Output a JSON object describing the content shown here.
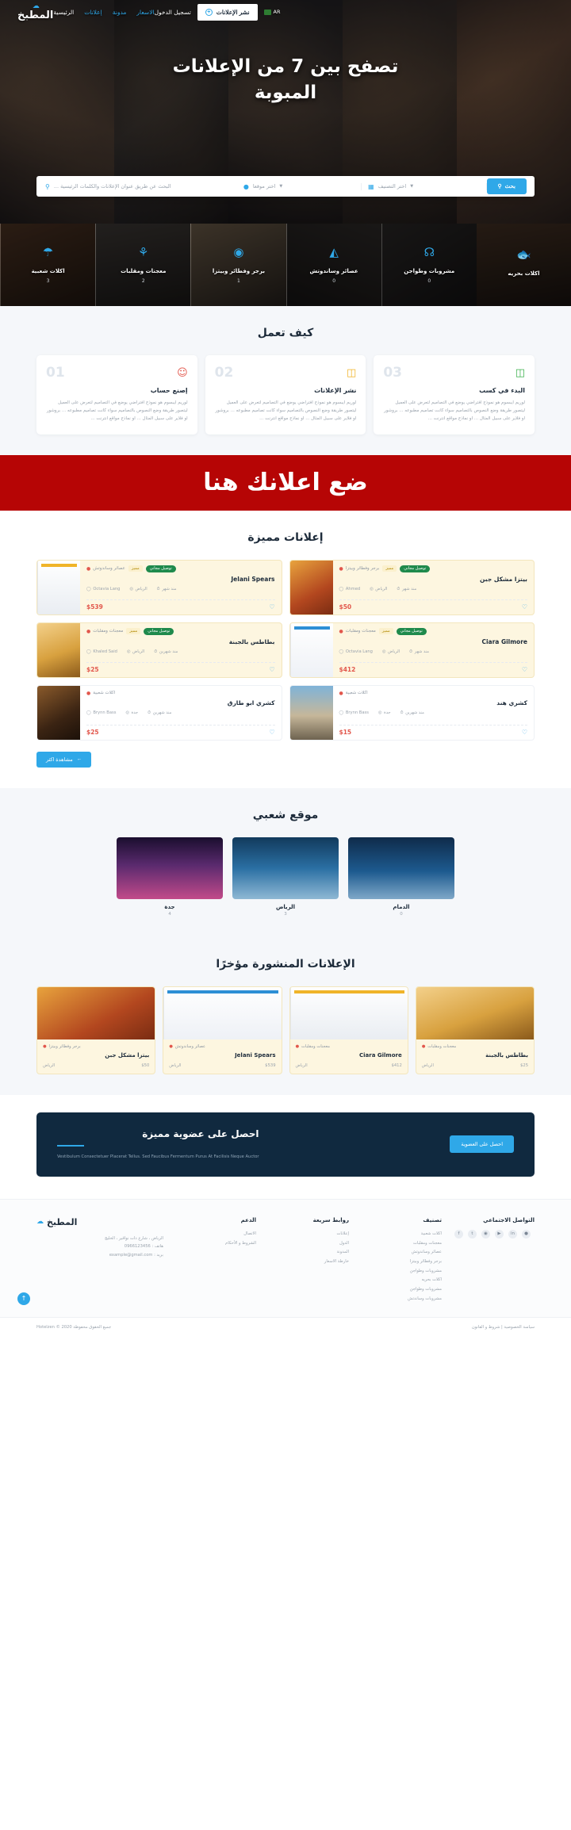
{
  "nav": {
    "logo_text": "المطبخ",
    "links": [
      {
        "label": "الرئيسية",
        "active": false
      },
      {
        "label": "إعلانات",
        "active": true
      },
      {
        "label": "مدونة",
        "active": true
      },
      {
        "label": "الاسعار",
        "active": true
      }
    ],
    "login_label": "تسجيل الدخول",
    "post_ad_label": "نشر الإعلانات",
    "lang_label": "AR"
  },
  "hero": {
    "title_line1": "تصفح بين 7 من الإعلانات",
    "title_line2": "المبوبة"
  },
  "search": {
    "keyword_placeholder": "البحث عن طريق عنوان الإعلانات والكلمات الرئيسية ...",
    "location_placeholder": "اختر موقعا",
    "category_placeholder": "اختر التصنيف",
    "button_label": "بحث"
  },
  "categories": [
    {
      "label": "اكلات شعبية",
      "count": "3",
      "icon": "dome-tray-icon"
    },
    {
      "label": "معجنات ومقلبات",
      "count": "2",
      "icon": "chef-tools-icon"
    },
    {
      "label": "برجر وفطائر وبيتزا",
      "count": "1",
      "icon": "pizza-icon"
    },
    {
      "label": "عصائر وساندوتش",
      "count": "0",
      "icon": "juice-cup-icon"
    },
    {
      "label": "مشروبات وطواجن",
      "count": "0",
      "icon": "grill-icon"
    },
    {
      "label": "اكلات بحريه",
      "count": "",
      "icon": "fish-icon"
    }
  ],
  "how_it_works": {
    "title": "كيف تعمل",
    "body_text": "لوريم ايبسوم هو نموذج افتراضي يوضع في التصاميم لتعرض على العميل ليتصور طريقة وضع النصوص بالتصاميم سواء كانت تصاميم مطبوعه ... بروشور او فلاير على سبيل المثال ... او نماذج مواقع انترنت ...",
    "cards": [
      {
        "num": "01",
        "title": "إصنع حساب",
        "icon": "add-user-icon"
      },
      {
        "num": "02",
        "title": "نشر الإعلانات",
        "icon": "notepad-icon"
      },
      {
        "num": "03",
        "title": "البدء في كسب",
        "icon": "package-icon"
      }
    ]
  },
  "ad_banner": {
    "text": "ضع اعلانك هنا"
  },
  "featured": {
    "title": "إعلانات مميزة",
    "see_all_label": "مشاهدة اكثر",
    "badges": {
      "featured": "مميز",
      "free_delivery": "توصيل مجاني"
    },
    "ads": [
      {
        "title": "بيتزا مشكل جبن",
        "category": "برجر وفطائر وبيتزا",
        "author": "Ahmed",
        "location": "الرياض",
        "time": "منذ شهر",
        "price": "$50",
        "featured": true,
        "free_delivery": true,
        "thumb": "th-pizza"
      },
      {
        "title": "Jelani Spears",
        "category": "عصائر وساندوتش",
        "author": "Octavia Lang",
        "location": "الرياض",
        "time": "منذ شهر",
        "price": "$539",
        "featured": true,
        "free_delivery": true,
        "thumb": "th-sheet"
      },
      {
        "title": "Ciara Gilmore",
        "category": "معجنات ومقلبات",
        "author": "Octavia Lang",
        "location": "الرياض",
        "time": "منذ شهر",
        "price": "$412",
        "featured": true,
        "free_delivery": true,
        "thumb": "th-table"
      },
      {
        "title": "بطاطس بالجبنة",
        "category": "معجنات ومقلبات",
        "author": "Khaled Said",
        "location": "الرياض",
        "time": "منذ شهرين",
        "price": "$25",
        "featured": true,
        "free_delivery": true,
        "thumb": "th-fries"
      },
      {
        "title": "كشري هند",
        "category": "اكلات شعبية",
        "author": "Brynn Bass",
        "location": "جدة",
        "time": "منذ شهرين",
        "price": "$15",
        "featured": false,
        "free_delivery": false,
        "thumb": "th-city"
      },
      {
        "title": "كشري ابو طارق",
        "category": "اكلات شعبية",
        "author": "Brynn Bass",
        "location": "جدة",
        "time": "منذ شهرين",
        "price": "$25",
        "featured": false,
        "free_delivery": false,
        "thumb": "th-grill"
      }
    ]
  },
  "locations": {
    "title": "موقع شعبي",
    "items": [
      {
        "name": "جدة",
        "count": "4",
        "img": "lc3"
      },
      {
        "name": "الرياض",
        "count": "3",
        "img": "lc2"
      },
      {
        "name": "الدمام",
        "count": "0",
        "img": "lc1"
      }
    ]
  },
  "recent": {
    "title": "الإعلانات المنشورة مؤخرًا",
    "items": [
      {
        "title": "بيتزا مشكل جبن",
        "category": "برجر وفطائر وبيتزا",
        "price": "$50",
        "location": "الرياض",
        "featured": true,
        "img": "th-pizza"
      },
      {
        "title": "Jelani Spears",
        "category": "عصائر وساندوتش",
        "price": "$539",
        "location": "الرياض",
        "featured": true,
        "img": "th-table"
      },
      {
        "title": "Ciara Gilmore",
        "category": "معجنات ومقلبات",
        "price": "$412",
        "location": "الرياض",
        "featured": true,
        "img": "th-sheet"
      },
      {
        "title": "بطاطس بالجبنة",
        "category": "معجنات ومقلبات",
        "price": "$25",
        "location": "الرياض",
        "featured": true,
        "img": "th-fries"
      }
    ]
  },
  "membership": {
    "title": "احصل على عضوية مميزة",
    "subtitle": "Vestibulum Consectetuer Placerat Tellus. Sed Faucibus Fermentum Purus At Facilisis Neque Auctor",
    "button_label": "احصل على العضوية"
  },
  "footer": {
    "brand_name": "المطبخ",
    "address": "الرياض ، شارع ذات نواقير ، الخليج",
    "phone": "هاتف : 0966123456",
    "email": "بريد : example@gmail.com",
    "columns": [
      {
        "title": "الدعم",
        "items": [
          "الاتصال",
          "الشروط و الأحكام"
        ]
      },
      {
        "title": "روابط سريعة",
        "items": [
          "إعلانات",
          "الدول",
          "المدونة",
          "خارطة الاسعار"
        ]
      },
      {
        "title": "تصنيف",
        "items": [
          "اكلات شعبية",
          "معجنات ومقلبات",
          "عصائر وساندوتش",
          "برجر وفطائر وبيتزا",
          "مشروبات وطواجن",
          "اكلات بحريه",
          "مشروبات وطواجن",
          "مشروبات وساندتش"
        ]
      }
    ],
    "social_title": "التواصل الاجتماعي",
    "socials": [
      "facebook-icon",
      "twitter-icon",
      "instagram-icon",
      "youtube-icon",
      "linkedin-icon",
      "pinterest-icon"
    ],
    "copyright": "جميع الحقوق محفوظة 2020 © Hotelzen",
    "policy_links": "سياسة الخصوصية | شروط و القانون"
  }
}
